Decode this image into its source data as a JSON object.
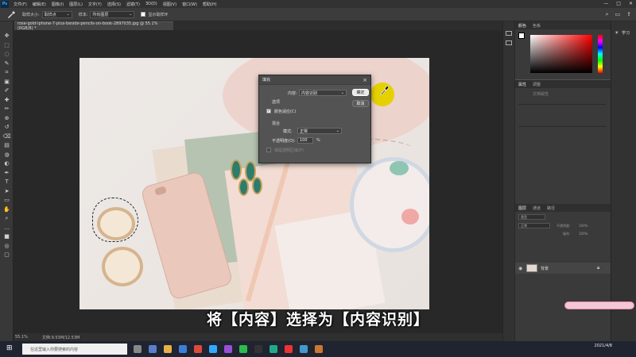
{
  "app": {
    "logo": "Ps",
    "menu": [
      "文件(F)",
      "编辑(E)",
      "图像(I)",
      "图层(L)",
      "文字(Y)",
      "选择(S)",
      "滤镜(T)",
      "3D(D)",
      "视图(V)",
      "窗口(W)",
      "帮助(H)"
    ],
    "window_controls": [
      "—",
      "□",
      "✕"
    ]
  },
  "options_bar": {
    "sample_size_label": "取样大小:",
    "sample_size_value": "取样点",
    "sample_label": "样本:",
    "sample_value": "所有图层",
    "show_ring_label": "显示取样环"
  },
  "document": {
    "tab_title": "rose-gold-iphone-7-plus-beside-pencils-on-book-2897035.jpg @ 55.1%(RGB/8) *",
    "zoom": "55.1%",
    "doc_info": "文档:9.53M/12.53M"
  },
  "dialog": {
    "title": "填充",
    "content_label": "内容:",
    "content_value": "内容识别",
    "options_label": "选项",
    "color_adapt_label": "颜色适应(C)",
    "color_adapt_checked": true,
    "blending_label": "混合",
    "mode_label": "模式:",
    "mode_value": "正常",
    "opacity_label": "不透明度(O):",
    "opacity_value": "100",
    "opacity_unit": "%",
    "preserve_label": "保留透明区域(P)",
    "ok_label": "确定",
    "cancel_label": "取消"
  },
  "panels": {
    "color_tabs": [
      "颜色",
      "色板"
    ],
    "properties_tabs": [
      "属性",
      "调整"
    ],
    "properties_doc_label": "文档属性",
    "layers_tabs": [
      "图层",
      "通道",
      "路径"
    ],
    "layers_kind": "类型",
    "layers_mode": "正常",
    "layers_opacity_label": "不透明度:",
    "layers_opacity_value": "100%",
    "layers_fill_label": "填充:",
    "layers_fill_value": "100%",
    "layer_name": "背景",
    "learn_label": "学习"
  },
  "subtitle": "将【内容】选择为【内容识别】",
  "taskbar": {
    "search_placeholder": "在这里输入你要搜索的内容",
    "time": "",
    "date": "2021/4/8"
  },
  "colors": {
    "accent_yellow": "#e5d000",
    "ok_button": "#e8e8e8",
    "ps_blue": "#31a8ff"
  }
}
